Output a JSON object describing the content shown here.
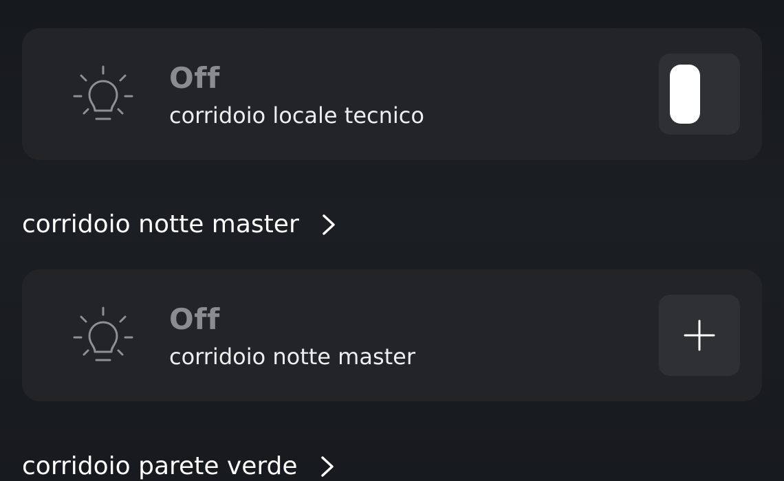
{
  "cards": [
    {
      "state": "Off",
      "name": "corridoio locale tecnico",
      "control": "toggle-switch"
    },
    {
      "state": "Off",
      "name": "corridoio notte master",
      "control": "plus-button"
    }
  ],
  "sections": [
    {
      "label": "corridoio notte master",
      "icon": "chevron-right-icon"
    },
    {
      "label": "corridoio parete verde",
      "icon": "chevron-right-icon"
    }
  ],
  "icons": {
    "light": "lightbulb-icon",
    "add": "plus-icon"
  },
  "colors": {
    "background": "#16191d",
    "card": "#222427",
    "control_bg": "#2e3033",
    "state_text": "#8a8c8e",
    "text": "#ffffff"
  }
}
